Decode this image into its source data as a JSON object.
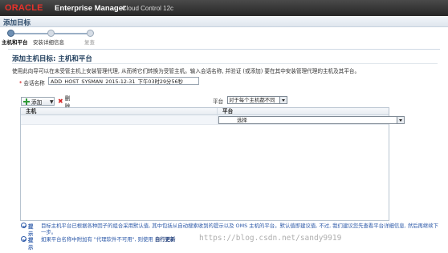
{
  "app": {
    "logo": "ORACLE",
    "product": "Enterprise Manager",
    "edition": "Cloud Control 12c"
  },
  "page": {
    "title": "添加目标"
  },
  "train": {
    "steps": [
      {
        "label": "主机和平台",
        "state": "current"
      },
      {
        "label": "安装详细信息",
        "state": "normal"
      },
      {
        "label": "复查",
        "state": "pending"
      }
    ]
  },
  "section": {
    "title": "添加主机目标: 主机和平台",
    "instruction": "使用此向导可以在未受管主机上安装管理代理, 从而将它们转换为受管主机。输入会话名称, 并验证 (或添加) 要在其中安装管理代理的主机及其平台。"
  },
  "session": {
    "label": "会话名称",
    "value": "ADD_HOST_SYSMAN_2015-12-31_下午03时29分56秒"
  },
  "toolbar": {
    "add_label": "添加",
    "delete_label": "删除",
    "platform_label": "平台",
    "platform_value": "对于每个主机都不同"
  },
  "table": {
    "columns": [
      "主机",
      "平台"
    ],
    "rows": [
      {
        "host": "",
        "platform": "选择"
      }
    ]
  },
  "tips": [
    {
      "label": "提示",
      "text": "目标主机平台已根据各种因子的组合采用默认值, 其中包括从自动搜索收到的提示以及 OMS 主机的平台。默认值即建议值, 不过, 我们建议您先查看平台详细信息, 然后再继续下一步。",
      "action": ""
    },
    {
      "label": "提示",
      "text": "如果平台名称中附加有 \"代理软件不可用\", 则使用",
      "action": "自行更新"
    }
  ],
  "watermark": "https://blog.csdn.net/sandy9919",
  "colors": {
    "brand_red": "#e8322b",
    "header_dark": "#262626",
    "title_blue": "#2d4b6a",
    "tip_blue": "#2b58a8"
  }
}
